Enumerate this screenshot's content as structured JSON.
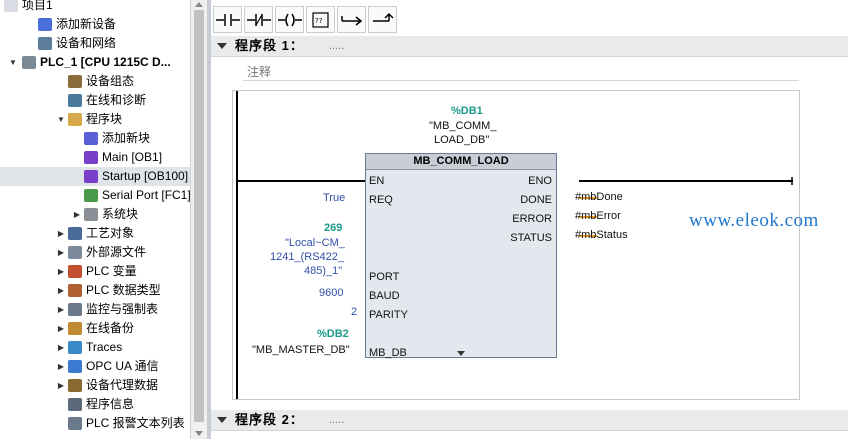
{
  "tree": {
    "items": [
      {
        "label": "项目1",
        "icon": "project-icon",
        "toggle": "none",
        "indent": 0,
        "selected": false
      },
      {
        "label": "添加新设备",
        "icon": "add-device-icon",
        "toggle": "none",
        "indent": 1,
        "selected": false
      },
      {
        "label": "设备和网络",
        "icon": "devices-networks-icon",
        "toggle": "none",
        "indent": 1,
        "selected": false
      },
      {
        "label": "PLC_1 [CPU 1215C D...",
        "icon": "plc-icon",
        "toggle": "open",
        "indent": 0,
        "selected": false,
        "bold": true
      },
      {
        "label": "设备组态",
        "icon": "device-config-icon",
        "toggle": "none",
        "indent": 2,
        "selected": false
      },
      {
        "label": "在线和诊断",
        "icon": "online-diagnostics-icon",
        "toggle": "none",
        "indent": 2,
        "selected": false
      },
      {
        "label": "程序块",
        "icon": "folder-icon",
        "toggle": "open",
        "indent": 2,
        "selected": false
      },
      {
        "label": "添加新块",
        "icon": "add-block-icon",
        "toggle": "none",
        "indent": 3,
        "selected": false
      },
      {
        "label": "Main [OB1]",
        "icon": "ob-block-icon",
        "toggle": "none",
        "indent": 3,
        "selected": false
      },
      {
        "label": "Startup [OB100]",
        "icon": "ob-block-icon",
        "toggle": "none",
        "indent": 3,
        "selected": true
      },
      {
        "label": "Serial Port [FC1]",
        "icon": "fc-block-icon",
        "toggle": "none",
        "indent": 3,
        "selected": false
      },
      {
        "label": "系统块",
        "icon": "system-blocks-icon",
        "toggle": "closed",
        "indent": 3,
        "selected": false
      },
      {
        "label": "工艺对象",
        "icon": "technology-objects-icon",
        "toggle": "closed",
        "indent": 2,
        "selected": false
      },
      {
        "label": "外部源文件",
        "icon": "external-source-icon",
        "toggle": "closed",
        "indent": 2,
        "selected": false
      },
      {
        "label": "PLC 变量",
        "icon": "plc-tags-icon",
        "toggle": "closed",
        "indent": 2,
        "selected": false
      },
      {
        "label": "PLC 数据类型",
        "icon": "plc-data-types-icon",
        "toggle": "closed",
        "indent": 2,
        "selected": false
      },
      {
        "label": "监控与强制表",
        "icon": "watch-force-table-icon",
        "toggle": "closed",
        "indent": 2,
        "selected": false
      },
      {
        "label": "在线备份",
        "icon": "online-backup-icon",
        "toggle": "closed",
        "indent": 2,
        "selected": false
      },
      {
        "label": "Traces",
        "icon": "traces-icon",
        "toggle": "closed",
        "indent": 2,
        "selected": false
      },
      {
        "label": "OPC UA 通信",
        "icon": "opc-ua-icon",
        "toggle": "closed",
        "indent": 2,
        "selected": false
      },
      {
        "label": "设备代理数据",
        "icon": "device-proxy-icon",
        "toggle": "closed",
        "indent": 2,
        "selected": false
      },
      {
        "label": "程序信息",
        "icon": "program-info-icon",
        "toggle": "none",
        "indent": 2,
        "selected": false
      },
      {
        "label": "PLC 报警文本列表",
        "icon": "alarm-text-icon",
        "toggle": "none",
        "indent": 2,
        "selected": false
      }
    ]
  },
  "toolbar": {
    "buttons": [
      {
        "name": "no-contact-icon",
        "kind": "no"
      },
      {
        "name": "nc-contact-icon",
        "kind": "nc"
      },
      {
        "name": "coil-icon",
        "kind": "coil"
      },
      {
        "name": "empty-box-icon",
        "kind": "box"
      },
      {
        "name": "open-branch-icon",
        "kind": "open"
      },
      {
        "name": "close-branch-icon",
        "kind": "close"
      }
    ],
    "box_glyph": "??"
  },
  "segments": [
    {
      "title": "程序段 1：",
      "dots": "....."
    },
    {
      "title": "程序段 2：",
      "dots": "....."
    }
  ],
  "comment_placeholder": "注释",
  "block": {
    "instance_address": "%DB1",
    "instance_name_line1": "\"MB_COMM_",
    "instance_name_line2": "LOAD_DB\"",
    "type": "MB_COMM_LOAD",
    "inputs": {
      "en": "EN",
      "req": "REQ",
      "port": "PORT",
      "baud": "BAUD",
      "parity": "PARITY",
      "mb_db": "MB_DB"
    },
    "outputs": {
      "eno": "ENO",
      "done": "DONE",
      "error": "ERROR",
      "status": "STATUS"
    },
    "req_value": "True",
    "port_value": "269",
    "port_name_line1": "\"Local~CM_",
    "port_name_line2": "1241_(RS422_",
    "port_name_line3": "485)_1\"",
    "baud_value": "9600",
    "parity_value": "2",
    "mbdb_address": "%DB2",
    "mbdb_name": "\"MB_MASTER_DB\"",
    "done_tag": "#mbDone",
    "error_tag": "#mbError",
    "status_tag": "#mbStatus"
  },
  "watermark": "www.eleok.com",
  "colors": {
    "teal": "#1a9a8a",
    "blue": "#3050a8",
    "orange": "#f0a020",
    "selected_row": "#dfe4e9"
  }
}
